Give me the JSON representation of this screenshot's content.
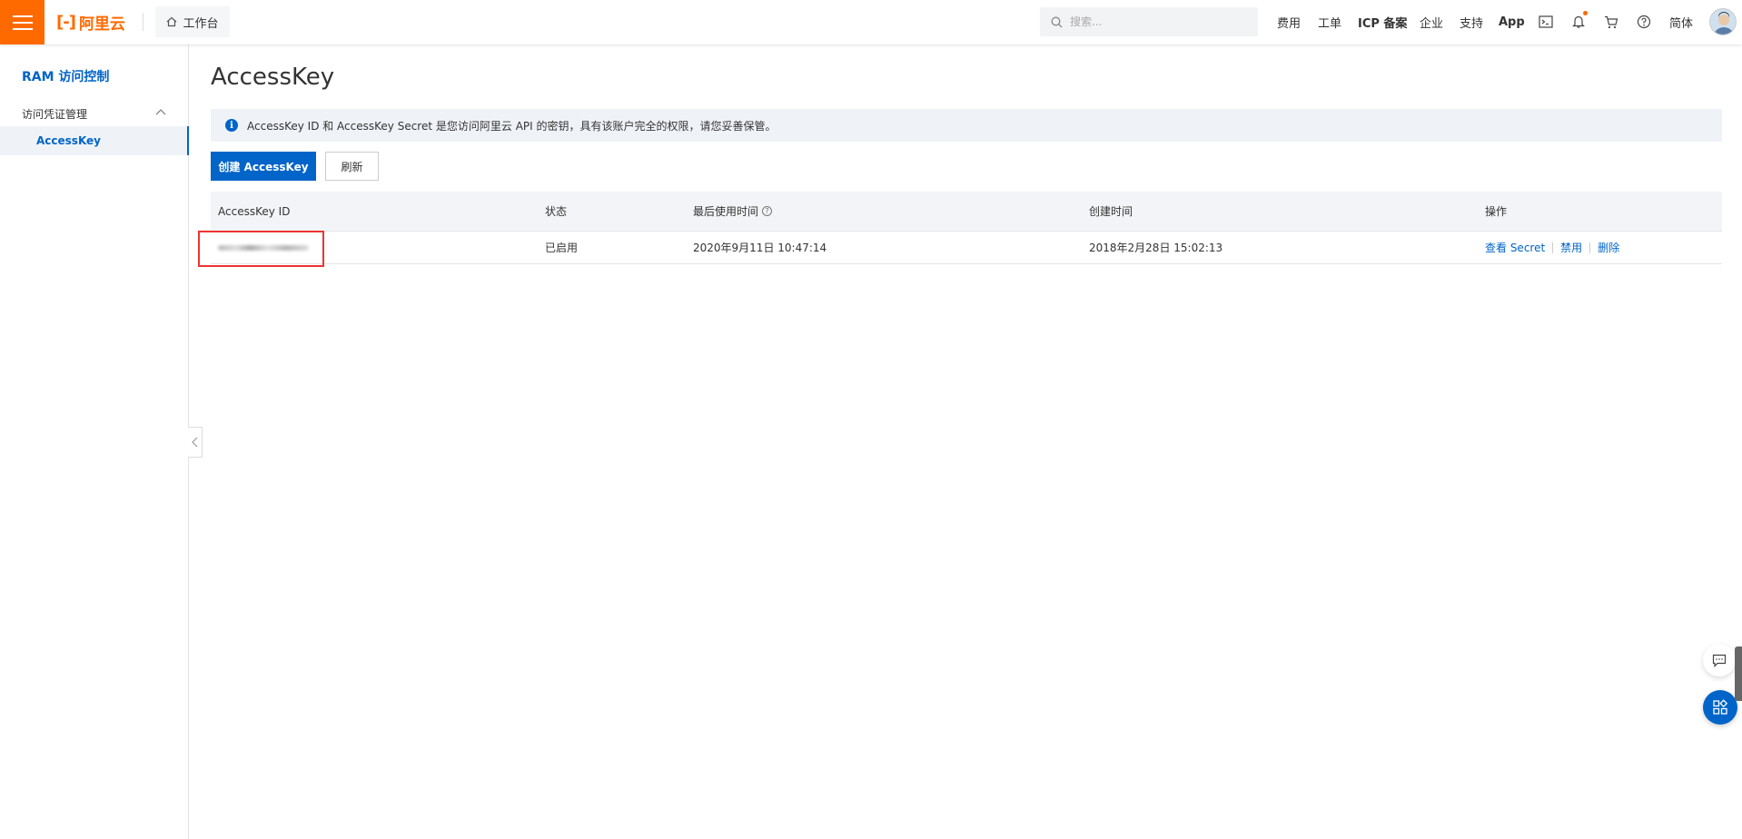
{
  "brand": {
    "logo_text": "阿里云",
    "logo_mark": "[-]",
    "accent": "#ff6a00",
    "primary": "#0064c8"
  },
  "topbar": {
    "workbench_label": "工作台",
    "search_placeholder": "搜索...",
    "nav": {
      "fees": "费用",
      "tickets": "工单",
      "icp": "ICP 备案",
      "enterprise": "企业",
      "support": "支持",
      "app": "App",
      "language": "简体"
    },
    "icons": [
      "terminal-icon",
      "bell-icon",
      "cart-icon",
      "help-icon"
    ]
  },
  "sidebar": {
    "title": "RAM 访问控制",
    "group_label": "访问凭证管理",
    "active_item": "AccessKey"
  },
  "page": {
    "title": "AccessKey",
    "alert": "AccessKey ID 和 AccessKey Secret 是您访问阿里云 API 的密钥，具有该账户完全的权限，请您妥善保管。",
    "create_button": "创建 AccessKey",
    "refresh_button": "刷新"
  },
  "table": {
    "headers": {
      "id": "AccessKey ID",
      "status": "状态",
      "last_used": "最后使用时间",
      "created": "创建时间",
      "actions": "操作"
    },
    "rows": [
      {
        "status": "已启用",
        "last_used": "2020年9月11日 10:47:14",
        "created": "2018年2月28日 15:02:13",
        "action_view": "查看 Secret",
        "action_disable": "禁用",
        "action_delete": "删除"
      }
    ]
  }
}
